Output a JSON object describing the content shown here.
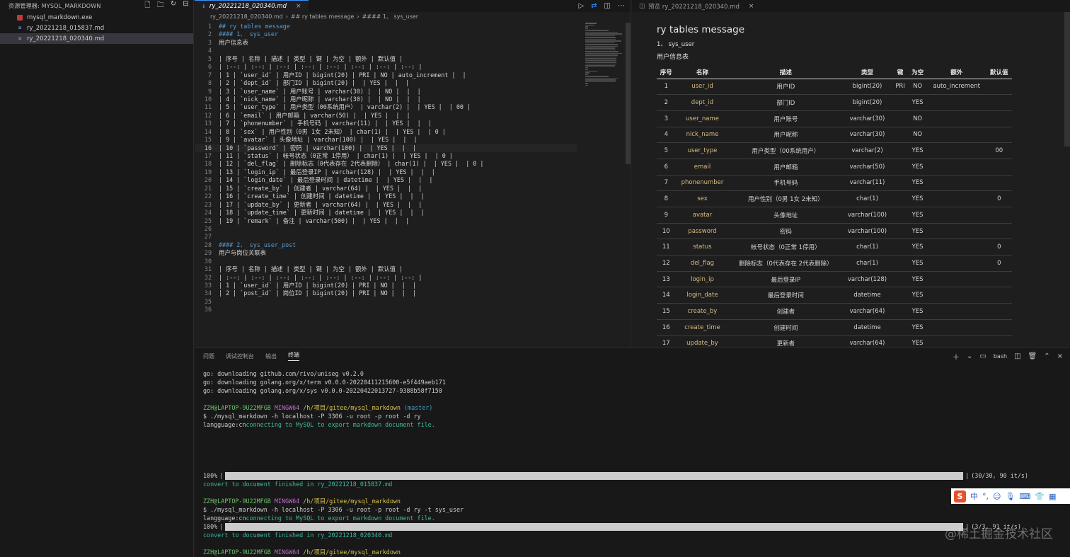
{
  "explorer": {
    "title": "资源管理器: MYSQL_MARKDOWN",
    "files": [
      {
        "name": "mysql_markdown.exe",
        "icon": "exe-file-icon",
        "selected": false
      },
      {
        "name": "ry_20221218_015837.md",
        "icon": "markdown-file-icon",
        "selected": false
      },
      {
        "name": "ry_20221218_020340.md",
        "icon": "markdown-file-icon",
        "selected": true
      }
    ]
  },
  "editor": {
    "tab_label": "ry_20221218_020340.md",
    "breadcrumb": [
      "ry_20221218_020340.md",
      "## ry tables message",
      "#### 1、 sys_user"
    ],
    "lines": [
      {
        "n": "1",
        "t": "## ry tables message",
        "h": true
      },
      {
        "n": "2",
        "t": "#### 1、 sys_user",
        "h": true
      },
      {
        "n": "3",
        "t": "用户信息表"
      },
      {
        "n": "4",
        "t": ""
      },
      {
        "n": "5",
        "t": "| 序号 | 名称 | 描述 | 类型 | 键 | 为空 | 额外 | 默认值 |"
      },
      {
        "n": "6",
        "t": "| :--: | :--: | :--: | :--: | :--: | :--: | :--: | :--: |"
      },
      {
        "n": "7",
        "t": "| 1 | `user_id` | 用户ID | bigint(20) | PRI | NO | auto_increment |  |"
      },
      {
        "n": "8",
        "t": "| 2 | `dept_id` | 部门ID | bigint(20) |  | YES |  |  |"
      },
      {
        "n": "9",
        "t": "| 3 | `user_name` | 用户账号 | varchar(30) |  | NO |  |  |"
      },
      {
        "n": "10",
        "t": "| 4 | `nick_name` | 用户昵称 | varchar(30) |  | NO |  |  |"
      },
      {
        "n": "11",
        "t": "| 5 | `user_type` | 用户类型（00系统用户） | varchar(2) |  | YES |  | 00 |"
      },
      {
        "n": "12",
        "t": "| 6 | `email` | 用户邮箱 | varchar(50) |  | YES |  |  |"
      },
      {
        "n": "13",
        "t": "| 7 | `phonenumber` | 手机号码 | varchar(11) |  | YES |  |  |"
      },
      {
        "n": "14",
        "t": "| 8 | `sex` | 用户性别（0男 1女 2未知） | char(1) |  | YES |  | 0 |"
      },
      {
        "n": "15",
        "t": "| 9 | `avatar` | 头像地址 | varchar(100) |  | YES |  |  |"
      },
      {
        "n": "16",
        "t": "| 10 | `password` | 密码 | varchar(100) |  | YES |  |  |",
        "cur": true
      },
      {
        "n": "17",
        "t": "| 11 | `status` | 帐号状态（0正常 1停用） | char(1) |  | YES |  | 0 |"
      },
      {
        "n": "18",
        "t": "| 12 | `del_flag` | 删除标志（0代表存在 2代表删除） | char(1) |  | YES |  | 0 |"
      },
      {
        "n": "19",
        "t": "| 13 | `login_ip` | 最后登录IP | varchar(128) |  | YES |  |  |"
      },
      {
        "n": "20",
        "t": "| 14 | `login_date` | 最后登录时间 | datetime |  | YES |  |  |"
      },
      {
        "n": "21",
        "t": "| 15 | `create_by` | 创建者 | varchar(64) |  | YES |  |  |"
      },
      {
        "n": "22",
        "t": "| 16 | `create_time` | 创建时间 | datetime |  | YES |  |  |"
      },
      {
        "n": "23",
        "t": "| 17 | `update_by` | 更新者 | varchar(64) |  | YES |  |  |"
      },
      {
        "n": "24",
        "t": "| 18 | `update_time` | 更新时间 | datetime |  | YES |  |  |"
      },
      {
        "n": "25",
        "t": "| 19 | `remark` | 备注 | varchar(500) |  | YES |  |  |"
      },
      {
        "n": "26",
        "t": ""
      },
      {
        "n": "27",
        "t": ""
      },
      {
        "n": "28",
        "t": "#### 2、 sys_user_post",
        "h": true
      },
      {
        "n": "29",
        "t": "用户与岗位关联表"
      },
      {
        "n": "30",
        "t": ""
      },
      {
        "n": "31",
        "t": "| 序号 | 名称 | 描述 | 类型 | 键 | 为空 | 额外 | 默认值 |"
      },
      {
        "n": "32",
        "t": "| :--: | :--: | :--: | :--: | :--: | :--: | :--: | :--: |"
      },
      {
        "n": "33",
        "t": "| 1 | `user_id` | 用户ID | bigint(20) | PRI | NO |  |  |"
      },
      {
        "n": "34",
        "t": "| 2 | `post_id` | 岗位ID | bigint(20) | PRI | NO |  |  |"
      },
      {
        "n": "35",
        "t": ""
      },
      {
        "n": "36",
        "t": ""
      }
    ]
  },
  "preview": {
    "tab_label": "预览 ry_20221218_020340.md",
    "h2": "ry tables message",
    "h4": "1、 sys_user",
    "desc": "用户信息表",
    "columns": [
      "序号",
      "名称",
      "描述",
      "类型",
      "键",
      "为空",
      "额外",
      "默认值"
    ],
    "rows": [
      [
        "1",
        "user_id",
        "用户ID",
        "bigint(20)",
        "PRI",
        "NO",
        "auto_increment",
        ""
      ],
      [
        "2",
        "dept_id",
        "部门ID",
        "bigint(20)",
        "",
        "YES",
        "",
        ""
      ],
      [
        "3",
        "user_name",
        "用户账号",
        "varchar(30)",
        "",
        "NO",
        "",
        ""
      ],
      [
        "4",
        "nick_name",
        "用户昵称",
        "varchar(30)",
        "",
        "NO",
        "",
        ""
      ],
      [
        "5",
        "user_type",
        "用户类型（00系统用户）",
        "varchar(2)",
        "",
        "YES",
        "",
        "00"
      ],
      [
        "6",
        "email",
        "用户邮箱",
        "varchar(50)",
        "",
        "YES",
        "",
        ""
      ],
      [
        "7",
        "phonenumber",
        "手机号码",
        "varchar(11)",
        "",
        "YES",
        "",
        ""
      ],
      [
        "8",
        "sex",
        "用户性别（0男 1女 2未知）",
        "char(1)",
        "",
        "YES",
        "",
        "0"
      ],
      [
        "9",
        "avatar",
        "头像地址",
        "varchar(100)",
        "",
        "YES",
        "",
        ""
      ],
      [
        "10",
        "password",
        "密码",
        "varchar(100)",
        "",
        "YES",
        "",
        ""
      ],
      [
        "11",
        "status",
        "帐号状态（0正常 1停用）",
        "char(1)",
        "",
        "YES",
        "",
        "0"
      ],
      [
        "12",
        "del_flag",
        "删除标志（0代表存在 2代表删除）",
        "char(1)",
        "",
        "YES",
        "",
        "0"
      ],
      [
        "13",
        "login_ip",
        "最后登录IP",
        "varchar(128)",
        "",
        "YES",
        "",
        ""
      ],
      [
        "14",
        "login_date",
        "最后登录时间",
        "datetime",
        "",
        "YES",
        "",
        ""
      ],
      [
        "15",
        "create_by",
        "创建者",
        "varchar(64)",
        "",
        "YES",
        "",
        ""
      ],
      [
        "16",
        "create_time",
        "创建时间",
        "datetime",
        "",
        "YES",
        "",
        ""
      ],
      [
        "17",
        "update_by",
        "更新者",
        "varchar(64)",
        "",
        "YES",
        "",
        ""
      ]
    ]
  },
  "panel": {
    "tabs": [
      "问题",
      "调试控制台",
      "输出",
      "终端"
    ],
    "active_tab": "终端",
    "shell_label": "bash",
    "terminal": {
      "dl1": "go: downloading github.com/rivo/uniseg v0.2.0",
      "dl2": "go: downloading golang.org/x/term v0.0.0-20220411215600-e5f449aeb171",
      "dl3": "go: downloading golang.org/x/sys v0.0.0-20220422013727-9388b58f7150",
      "prompt_user": "ZZH@LAPTOP-9U22MFGB",
      "prompt_env": "MINGW64",
      "prompt_path1": "/h/项目/gitee/mysql_markdown",
      "prompt_branch": "(master)",
      "cmd1": "$ ./mysql_markdown -h localhost -P 3306 -u root -p root -d ry",
      "lang_label": "langguage:cn",
      "connecting": "connecting to MySQL to export markdown document file.",
      "pct1": "100%",
      "prog1": "(30/30, 90 it/s)",
      "done1": "convert to document finished in ry_20221218_015837.md",
      "prompt_path2": "/h/项目/gitee/mysql_markdown",
      "cmd2": "$ ./mysql_markdown -h localhost -P 3306 -u root -p root -d ry -t sys_user",
      "pct2": "100%",
      "prog2": "(3/3, 91 it/s)",
      "done2": "convert to document finished in ry_20221218_020340.md",
      "prompt_path3": "/h/项目/gitee/mysql_markdown",
      "ps": "$"
    }
  },
  "ime": {
    "logo": "S",
    "mode": "中"
  },
  "watermark": "@稀土掘金技术社区"
}
